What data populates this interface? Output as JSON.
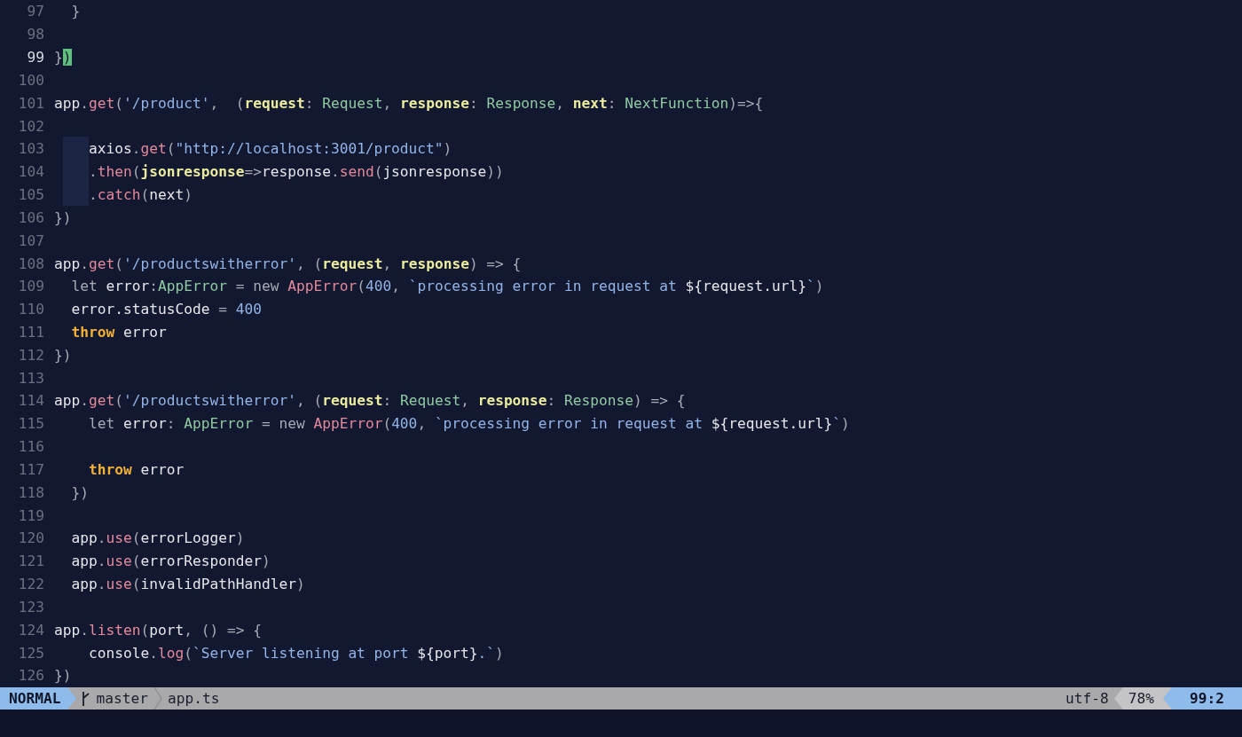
{
  "editor": {
    "lines": [
      {
        "number": "97",
        "current": false,
        "guide": false,
        "tokens": [
          {
            "kind": "punct",
            "text": "  }"
          }
        ]
      },
      {
        "number": "98",
        "current": false,
        "guide": false
      },
      {
        "number": "99",
        "current": true,
        "guide": false,
        "tokens": [
          {
            "kind": "punct",
            "text": "}"
          },
          {
            "kind": "cursor",
            "text": ")"
          }
        ]
      },
      {
        "number": "100",
        "current": false,
        "guide": false
      },
      {
        "number": "101",
        "current": false,
        "guide": false,
        "tokens": [
          {
            "kind": "plain",
            "text": "app"
          },
          {
            "kind": "punct",
            "text": "."
          },
          {
            "kind": "method",
            "text": "get"
          },
          {
            "kind": "punct",
            "text": "("
          },
          {
            "kind": "string",
            "text": "'/product'"
          },
          {
            "kind": "punct",
            "text": ",  ("
          },
          {
            "kind": "param",
            "text": "request"
          },
          {
            "kind": "punct",
            "text": ": "
          },
          {
            "kind": "type",
            "text": "Request"
          },
          {
            "kind": "punct",
            "text": ", "
          },
          {
            "kind": "param",
            "text": "response"
          },
          {
            "kind": "punct",
            "text": ": "
          },
          {
            "kind": "type",
            "text": "Response"
          },
          {
            "kind": "punct",
            "text": ", "
          },
          {
            "kind": "param",
            "text": "next"
          },
          {
            "kind": "punct",
            "text": ": "
          },
          {
            "kind": "type",
            "text": "NextFunction"
          },
          {
            "kind": "punct",
            "text": ")=>{"
          }
        ]
      },
      {
        "number": "102",
        "current": false,
        "guide": false
      },
      {
        "number": "103",
        "current": false,
        "guide": true,
        "tokens": [
          {
            "kind": "plain",
            "text": "    axios"
          },
          {
            "kind": "punct",
            "text": "."
          },
          {
            "kind": "method",
            "text": "get"
          },
          {
            "kind": "punct",
            "text": "("
          },
          {
            "kind": "string",
            "text": "\"http://localhost:3001/product\""
          },
          {
            "kind": "punct",
            "text": ")"
          }
        ]
      },
      {
        "number": "104",
        "current": false,
        "guide": true,
        "tokens": [
          {
            "kind": "punct",
            "text": "    ."
          },
          {
            "kind": "method",
            "text": "then"
          },
          {
            "kind": "punct",
            "text": "("
          },
          {
            "kind": "param",
            "text": "jsonresponse"
          },
          {
            "kind": "punct",
            "text": "=>"
          },
          {
            "kind": "plain",
            "text": "response"
          },
          {
            "kind": "punct",
            "text": "."
          },
          {
            "kind": "method",
            "text": "send"
          },
          {
            "kind": "punct",
            "text": "("
          },
          {
            "kind": "plain",
            "text": "jsonresponse"
          },
          {
            "kind": "punct",
            "text": "))"
          }
        ]
      },
      {
        "number": "105",
        "current": false,
        "guide": true,
        "tokens": [
          {
            "kind": "punct",
            "text": "    ."
          },
          {
            "kind": "method",
            "text": "catch"
          },
          {
            "kind": "punct",
            "text": "("
          },
          {
            "kind": "plain",
            "text": "next"
          },
          {
            "kind": "punct",
            "text": ")"
          }
        ]
      },
      {
        "number": "106",
        "current": false,
        "guide": false,
        "tokens": [
          {
            "kind": "punct",
            "text": "})"
          }
        ]
      },
      {
        "number": "107",
        "current": false,
        "guide": false
      },
      {
        "number": "108",
        "current": false,
        "guide": false,
        "tokens": [
          {
            "kind": "plain",
            "text": "app"
          },
          {
            "kind": "punct",
            "text": "."
          },
          {
            "kind": "method",
            "text": "get"
          },
          {
            "kind": "punct",
            "text": "("
          },
          {
            "kind": "string",
            "text": "'/productswitherror'"
          },
          {
            "kind": "punct",
            "text": ", ("
          },
          {
            "kind": "param",
            "text": "request"
          },
          {
            "kind": "punct",
            "text": ", "
          },
          {
            "kind": "param",
            "text": "response"
          },
          {
            "kind": "punct",
            "text": ") => {"
          }
        ]
      },
      {
        "number": "109",
        "current": false,
        "guide": false,
        "tokens": [
          {
            "kind": "punct",
            "text": "  let "
          },
          {
            "kind": "plain",
            "text": "error"
          },
          {
            "kind": "punct",
            "text": ":"
          },
          {
            "kind": "type",
            "text": "AppError"
          },
          {
            "kind": "punct",
            "text": " = new "
          },
          {
            "kind": "method",
            "text": "AppError"
          },
          {
            "kind": "punct",
            "text": "("
          },
          {
            "kind": "number",
            "text": "400"
          },
          {
            "kind": "punct",
            "text": ", "
          },
          {
            "kind": "string",
            "text": "`processing error in request at "
          },
          {
            "kind": "plain",
            "text": "${request.url}"
          },
          {
            "kind": "string",
            "text": "`"
          },
          {
            "kind": "punct",
            "text": ")"
          }
        ]
      },
      {
        "number": "110",
        "current": false,
        "guide": false,
        "tokens": [
          {
            "kind": "plain",
            "text": "  error.statusCode"
          },
          {
            "kind": "punct",
            "text": " = "
          },
          {
            "kind": "number",
            "text": "400"
          }
        ]
      },
      {
        "number": "111",
        "current": false,
        "guide": false,
        "tokens": [
          {
            "kind": "keyword",
            "text": "  throw"
          },
          {
            "kind": "plain",
            "text": " error"
          }
        ]
      },
      {
        "number": "112",
        "current": false,
        "guide": false,
        "tokens": [
          {
            "kind": "punct",
            "text": "})"
          }
        ]
      },
      {
        "number": "113",
        "current": false,
        "guide": false
      },
      {
        "number": "114",
        "current": false,
        "guide": false,
        "tokens": [
          {
            "kind": "plain",
            "text": "app"
          },
          {
            "kind": "punct",
            "text": "."
          },
          {
            "kind": "method",
            "text": "get"
          },
          {
            "kind": "punct",
            "text": "("
          },
          {
            "kind": "string",
            "text": "'/productswitherror'"
          },
          {
            "kind": "punct",
            "text": ", ("
          },
          {
            "kind": "param",
            "text": "request"
          },
          {
            "kind": "punct",
            "text": ": "
          },
          {
            "kind": "type",
            "text": "Request"
          },
          {
            "kind": "punct",
            "text": ", "
          },
          {
            "kind": "param",
            "text": "response"
          },
          {
            "kind": "punct",
            "text": ": "
          },
          {
            "kind": "type",
            "text": "Response"
          },
          {
            "kind": "punct",
            "text": ") => {"
          }
        ]
      },
      {
        "number": "115",
        "current": false,
        "guide": false,
        "tokens": [
          {
            "kind": "punct",
            "text": "    let "
          },
          {
            "kind": "plain",
            "text": "error"
          },
          {
            "kind": "punct",
            "text": ": "
          },
          {
            "kind": "type",
            "text": "AppError"
          },
          {
            "kind": "punct",
            "text": " = new "
          },
          {
            "kind": "method",
            "text": "AppError"
          },
          {
            "kind": "punct",
            "text": "("
          },
          {
            "kind": "number",
            "text": "400"
          },
          {
            "kind": "punct",
            "text": ", "
          },
          {
            "kind": "string",
            "text": "`processing error in request at "
          },
          {
            "kind": "plain",
            "text": "${request.url}"
          },
          {
            "kind": "string",
            "text": "`"
          },
          {
            "kind": "punct",
            "text": ")"
          }
        ]
      },
      {
        "number": "116",
        "current": false,
        "guide": false
      },
      {
        "number": "117",
        "current": false,
        "guide": false,
        "tokens": [
          {
            "kind": "keyword",
            "text": "    throw"
          },
          {
            "kind": "plain",
            "text": " error"
          }
        ]
      },
      {
        "number": "118",
        "current": false,
        "guide": false,
        "tokens": [
          {
            "kind": "punct",
            "text": "  })"
          }
        ]
      },
      {
        "number": "119",
        "current": false,
        "guide": false
      },
      {
        "number": "120",
        "current": false,
        "guide": false,
        "tokens": [
          {
            "kind": "plain",
            "text": "  app"
          },
          {
            "kind": "punct",
            "text": "."
          },
          {
            "kind": "method",
            "text": "use"
          },
          {
            "kind": "punct",
            "text": "("
          },
          {
            "kind": "plain",
            "text": "errorLogger"
          },
          {
            "kind": "punct",
            "text": ")"
          }
        ]
      },
      {
        "number": "121",
        "current": false,
        "guide": false,
        "tokens": [
          {
            "kind": "plain",
            "text": "  app"
          },
          {
            "kind": "punct",
            "text": "."
          },
          {
            "kind": "method",
            "text": "use"
          },
          {
            "kind": "punct",
            "text": "("
          },
          {
            "kind": "plain",
            "text": "errorResponder"
          },
          {
            "kind": "punct",
            "text": ")"
          }
        ]
      },
      {
        "number": "122",
        "current": false,
        "guide": false,
        "tokens": [
          {
            "kind": "plain",
            "text": "  app"
          },
          {
            "kind": "punct",
            "text": "."
          },
          {
            "kind": "method",
            "text": "use"
          },
          {
            "kind": "punct",
            "text": "("
          },
          {
            "kind": "plain",
            "text": "invalidPathHandler"
          },
          {
            "kind": "punct",
            "text": ")"
          }
        ]
      },
      {
        "number": "123",
        "current": false,
        "guide": false
      },
      {
        "number": "124",
        "current": false,
        "guide": false,
        "tokens": [
          {
            "kind": "plain",
            "text": "app"
          },
          {
            "kind": "punct",
            "text": "."
          },
          {
            "kind": "method",
            "text": "listen"
          },
          {
            "kind": "punct",
            "text": "("
          },
          {
            "kind": "plain",
            "text": "port"
          },
          {
            "kind": "punct",
            "text": ", () => {"
          }
        ]
      },
      {
        "number": "125",
        "current": false,
        "guide": false,
        "tokens": [
          {
            "kind": "plain",
            "text": "    console"
          },
          {
            "kind": "punct",
            "text": "."
          },
          {
            "kind": "method",
            "text": "log"
          },
          {
            "kind": "punct",
            "text": "("
          },
          {
            "kind": "string",
            "text": "`Server listening at port "
          },
          {
            "kind": "plain",
            "text": "${port}"
          },
          {
            "kind": "string",
            "text": ".`"
          },
          {
            "kind": "punct",
            "text": ")"
          }
        ]
      },
      {
        "number": "126",
        "current": false,
        "guide": false,
        "tokens": [
          {
            "kind": "punct",
            "text": "})"
          }
        ]
      }
    ]
  },
  "status_bar": {
    "mode": "NORMAL",
    "branch": "master",
    "file": "app.ts",
    "encoding": "utf-8",
    "percent": "78%",
    "position": "99:2"
  }
}
